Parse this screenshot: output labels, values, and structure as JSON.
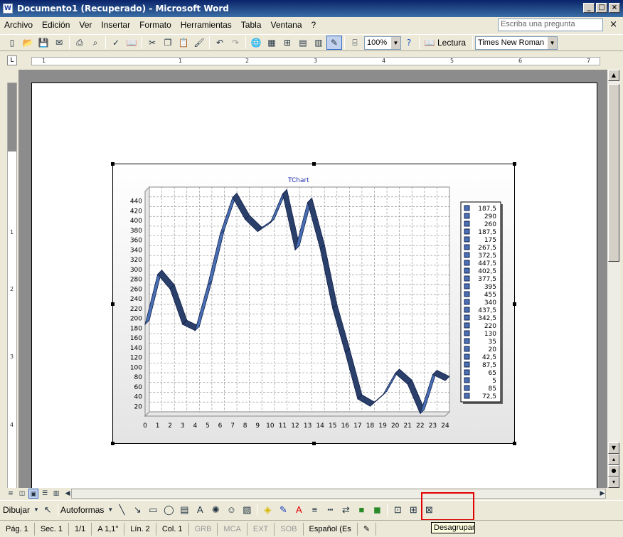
{
  "window": {
    "title": "Documento1 (Recuperado) - Microsoft Word",
    "app_icon_letter": "W",
    "buttons": [
      "_",
      "□",
      "×"
    ]
  },
  "menu": {
    "items": [
      "Archivo",
      "Edición",
      "Ver",
      "Insertar",
      "Formato",
      "Herramientas",
      "Tabla",
      "Ventana",
      "?"
    ],
    "help_placeholder": "Escriba una pregunta",
    "close_doc": "×"
  },
  "toolbar": {
    "zoom": "100%",
    "reading_label": "Lectura",
    "font": "Times New Roman"
  },
  "ruler": {
    "h_numbers": [
      "1",
      "1",
      "2",
      "3",
      "4",
      "5",
      "6",
      "7"
    ],
    "v_numbers": [
      "1",
      "2",
      "3",
      "4"
    ]
  },
  "chart_data": {
    "type": "line",
    "title": "TChart",
    "x": [
      0,
      1,
      2,
      3,
      4,
      5,
      6,
      7,
      8,
      9,
      10,
      11,
      12,
      13,
      14,
      15,
      16,
      17,
      18,
      19,
      20,
      21,
      22,
      23,
      24
    ],
    "values": [
      187.5,
      290,
      260,
      187.5,
      175,
      267.5,
      372.5,
      447.5,
      402.5,
      377.5,
      395,
      455,
      340,
      437.5,
      342.5,
      220,
      130,
      35,
      20,
      42.5,
      87.5,
      65,
      5,
      85,
      72.5
    ],
    "legend_labels": [
      "187,5",
      "290",
      "260",
      "187,5",
      "175",
      "267,5",
      "372,5",
      "447,5",
      "402,5",
      "377,5",
      "395",
      "455",
      "340",
      "437,5",
      "342,5",
      "220",
      "130",
      "35",
      "20",
      "42,5",
      "87,5",
      "65",
      "5",
      "85",
      "72,5"
    ],
    "y_ticks": [
      20,
      40,
      60,
      80,
      100,
      120,
      140,
      160,
      180,
      200,
      220,
      240,
      260,
      280,
      300,
      320,
      340,
      360,
      380,
      400,
      420,
      440
    ],
    "ylim": [
      0,
      460
    ],
    "xlim": [
      0,
      24
    ],
    "grid": true,
    "legend_position": "right",
    "style": "3d ribbon",
    "series_color": "#4a6fb5",
    "title_color": "#1c2fa8"
  },
  "drawing_toolbar": {
    "draw_label": "Dibujar",
    "autoshapes_label": "Autoformas",
    "tooltip": "Desagrupar"
  },
  "status": {
    "page": "Pág.  1",
    "section": "Sec.  1",
    "pages": "1/1",
    "at": "A  1,1\"",
    "line": "Lín.  2",
    "col": "Col.  1",
    "grb": "GRB",
    "mca": "MCA",
    "ext": "EXT",
    "sob": "SOB",
    "language": "Español (Es"
  }
}
